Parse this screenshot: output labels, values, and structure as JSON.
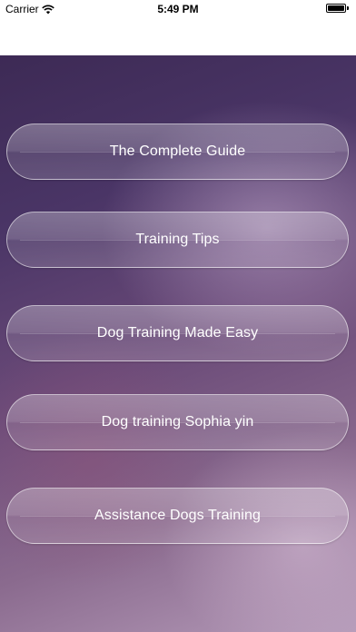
{
  "status_bar": {
    "carrier": "Carrier",
    "time": "5:49 PM",
    "wifi_icon": "wifi-icon",
    "battery_icon": "battery-icon",
    "battery_level": 1.0
  },
  "menu": {
    "buttons": [
      {
        "label": "The Complete Guide"
      },
      {
        "label": "Training Tips"
      },
      {
        "label": "Dog Training Made Easy"
      },
      {
        "label": "Dog training Sophia yin"
      },
      {
        "label": "Assistance Dogs Training"
      }
    ]
  },
  "colors": {
    "background_top": "#3d2a55",
    "background_bottom": "#b49ab8",
    "button_text": "#ffffff"
  }
}
